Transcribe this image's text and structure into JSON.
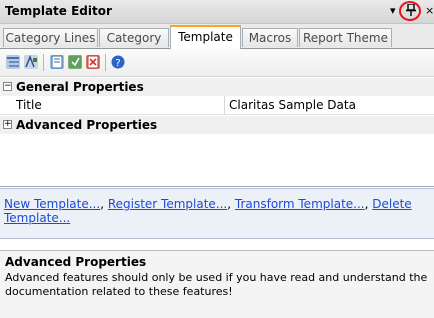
{
  "window": {
    "title": "Template Editor",
    "dropdown_glyph": "▾",
    "pin_glyph": "⊥",
    "close_glyph": "×"
  },
  "tabs": [
    {
      "label": "Category Lines",
      "active": false
    },
    {
      "label": "Category",
      "active": false
    },
    {
      "label": "Template",
      "active": true
    },
    {
      "label": "Macros",
      "active": false
    },
    {
      "label": "Report Theme",
      "active": false
    }
  ],
  "toolbar": {
    "icons": [
      "categorized-icon",
      "alphabetical-icon",
      "property-pages-icon",
      "events-icon",
      "clear-icon",
      "help-icon"
    ]
  },
  "grid": {
    "general": {
      "label": "General Properties",
      "expander": "−"
    },
    "title_row": {
      "name": "Title",
      "value": "Claritas Sample Data"
    },
    "advanced": {
      "label": "Advanced Properties",
      "expander": "+"
    }
  },
  "commands": [
    {
      "label": "New Template...",
      "sep": ", "
    },
    {
      "label": "Register Template...",
      "sep": ", "
    },
    {
      "label": "Transform Template...",
      "sep": ", "
    },
    {
      "label": "Delete Template...",
      "sep": ""
    }
  ],
  "help": {
    "title": "Advanced Properties",
    "body": "Advanced features should only be used if you have read and understand the documentation related to these features!"
  },
  "colors": {
    "active_tab_accent": "#f8a81e",
    "link": "#1d4ad6",
    "highlight_circle": "#e8141a"
  }
}
